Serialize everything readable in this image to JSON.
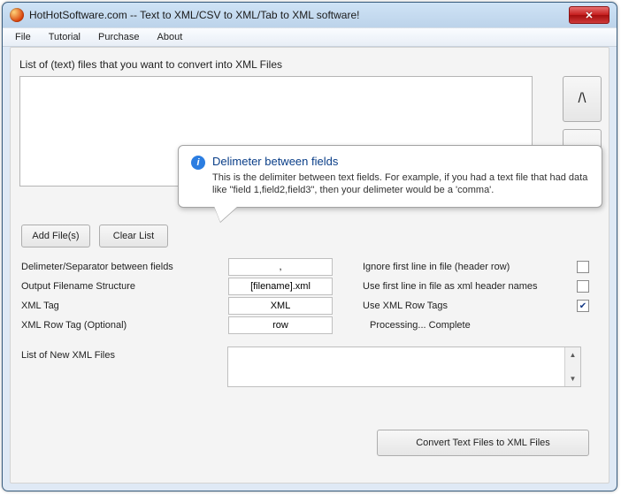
{
  "window": {
    "title": "HotHotSoftware.com -- Text to XML/CSV to XML/Tab to XML software!"
  },
  "menu": {
    "file": "File",
    "tutorial": "Tutorial",
    "purchase": "Purchase",
    "about": "About"
  },
  "labels": {
    "listTitle": "List of (text) files that you want to convert into XML Files",
    "delimiter": "Delimeter/Separator between fields",
    "outputFilename": "Output Filename Structure",
    "xmlTag": "XML Tag",
    "xmlRowTag": "XML Row Tag (Optional)",
    "newFiles": "List of New XML Files",
    "ignoreFirst": "Ignore first line in file (header row)",
    "useFirst": "Use first line in file as xml header names",
    "useRowTags": "Use XML Row Tags",
    "processing": "Processing... Complete"
  },
  "buttons": {
    "addFiles": "Add File(s)",
    "clearList": "Clear List",
    "up": "/\\",
    "down": "\\/",
    "convert": "Convert Text Files to XML Files"
  },
  "fields": {
    "delimiter": ",",
    "outputFilename": "[filename].xml",
    "xmlTag": "XML",
    "xmlRowTag": "row"
  },
  "checks": {
    "ignoreFirst": false,
    "useFirst": false,
    "useRowTags": true
  },
  "tooltip": {
    "title": "Delimeter between fields",
    "body": "This is the delimiter between text fields. For example, if you had a text file that had data like \"field 1,field2,field3\", then your delimeter would be a 'comma'."
  }
}
